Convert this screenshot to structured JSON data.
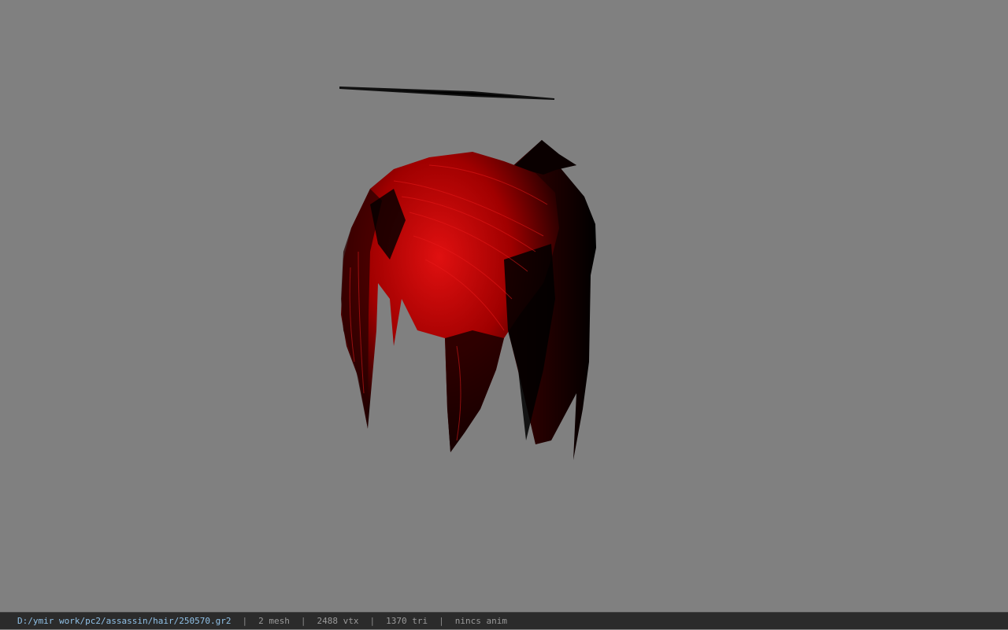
{
  "viewport": {
    "background": "#808080",
    "model": "hair-mesh",
    "colors": {
      "hair_dark": "#000000",
      "hair_red": "#c00000",
      "hair_highlight": "#e01010"
    }
  },
  "statusbar": {
    "file_path": "D:/ymir work/pc2/assassin/hair/250570.gr2",
    "separator": "|",
    "mesh_count": "2 mesh",
    "vertex_count": "2488 vtx",
    "triangle_count": "1370 tri",
    "anim_status": "nincs anim"
  }
}
